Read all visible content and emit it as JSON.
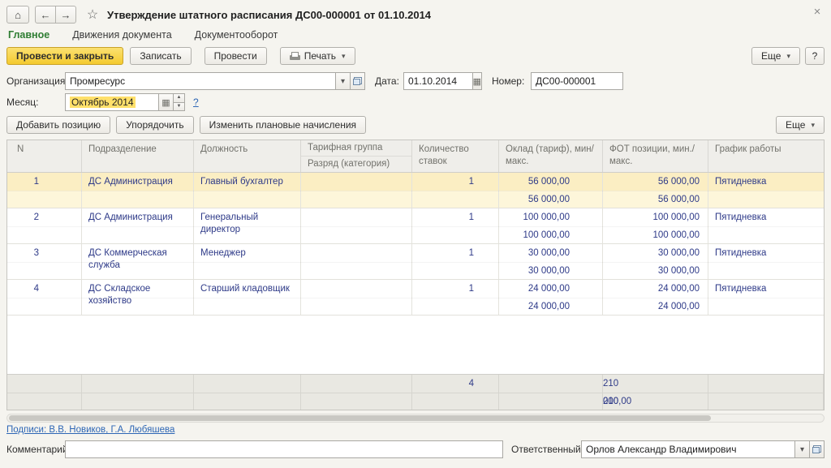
{
  "window": {
    "title": "Утверждение штатного расписания ДС00-000001 от 01.10.2014"
  },
  "icons": {
    "home": "⌂",
    "back": "←",
    "forward": "→",
    "favorite": "☆",
    "close": "×",
    "dropdown": "▾",
    "calendar": "▦",
    "spin_up": "▲",
    "spin_down": "▼"
  },
  "tabs": [
    {
      "label": "Главное",
      "active": true
    },
    {
      "label": "Движения документа",
      "active": false
    },
    {
      "label": "Документооборот",
      "active": false
    }
  ],
  "command_bar": {
    "post_and_close": "Провести и закрыть",
    "write": "Записать",
    "post": "Провести",
    "print": "Печать",
    "more": "Еще",
    "help": "?"
  },
  "form": {
    "organization": {
      "label": "Организация:",
      "value": "Промресурс"
    },
    "date": {
      "label": "Дата:",
      "value": "01.10.2014"
    },
    "number": {
      "label": "Номер:",
      "value": "ДС00-000001"
    },
    "month": {
      "label": "Месяц:",
      "value": "Октябрь 2014",
      "help": "?"
    }
  },
  "table_toolbar": {
    "add_position": "Добавить позицию",
    "sort": "Упорядочить",
    "change_accruals": "Изменить плановые начисления",
    "more": "Еще"
  },
  "table": {
    "columns": {
      "n": "N",
      "department": "Подразделение",
      "position": "Должность",
      "tariff_group": "Тарифная группа",
      "grade": "Разряд (категория)",
      "count": "Количество ставок",
      "salary": "Оклад (тариф), мин/макс.",
      "fot": "ФОТ позиции, мин./макс.",
      "schedule": "График работы"
    },
    "rows": [
      {
        "n": "1",
        "department": "ДС Администрация",
        "position": "Главный бухгалтер",
        "tariff_group": "",
        "grade": "",
        "count": "1",
        "salary_min": "56 000,00",
        "salary_max": "56 000,00",
        "fot_min": "56 000,00",
        "fot_max": "56 000,00",
        "schedule": "Пятидневка",
        "selected": true
      },
      {
        "n": "2",
        "department": "ДС Администрация",
        "position": "Генеральный директор",
        "tariff_group": "",
        "grade": "",
        "count": "1",
        "salary_min": "100 000,00",
        "salary_max": "100 000,00",
        "fot_min": "100 000,00",
        "fot_max": "100 000,00",
        "schedule": "Пятидневка",
        "selected": false
      },
      {
        "n": "3",
        "department": "ДС Коммерческая служба",
        "position": "Менеджер",
        "tariff_group": "",
        "grade": "",
        "count": "1",
        "salary_min": "30 000,00",
        "salary_max": "30 000,00",
        "fot_min": "30 000,00",
        "fot_max": "30 000,00",
        "schedule": "Пятидневка",
        "selected": false
      },
      {
        "n": "4",
        "department": "ДС Складское хозяйство",
        "position": "Старший кладовщик",
        "tariff_group": "",
        "grade": "",
        "count": "1",
        "salary_min": "24 000,00",
        "salary_max": "24 000,00",
        "fot_min": "24 000,00",
        "fot_max": "24 000,00",
        "schedule": "Пятидневка",
        "selected": false
      }
    ],
    "totals": {
      "count": "4",
      "fot_min": "210 000,00",
      "fot_max": "210 000,00"
    }
  },
  "footer": {
    "signatures": "Подписи: В.В. Новиков, Г.А. Любяшева",
    "comment_label": "Комментарий:",
    "responsible_label": "Ответственный:",
    "responsible_value": "Орлов Александр Владимирович"
  },
  "colors": {
    "primary_button_yellow": "#f4ca2f",
    "active_tab_green": "#2e7d32",
    "selected_row_yellow": "#fbeec3",
    "cell_text_navy": "#2e3a88",
    "link_blue": "#2d66b5"
  }
}
